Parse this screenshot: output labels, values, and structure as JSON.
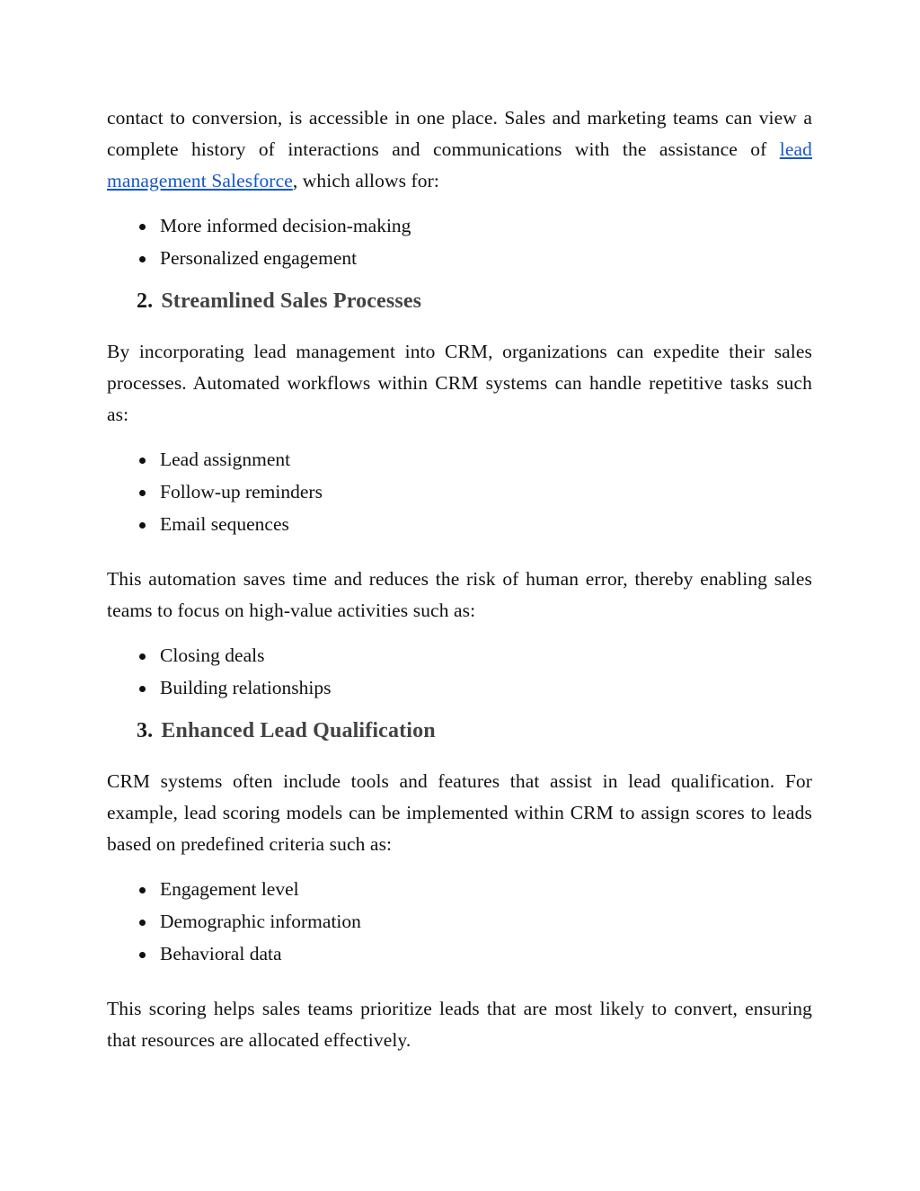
{
  "document": {
    "background_color": "#ffffff",
    "text_color": "#111111",
    "link_color": "#1457cc",
    "heading_color": "#434343",
    "heading_number_color": "#1a1a1a",
    "blocks": {
      "intro_paragraph": {
        "lead_text": "contact to conversion, is accessible in one place. Sales and marketing teams can view a complete history of interactions and communications with the assistance of ",
        "link_text": "lead management Salesforce",
        "tail_text": ", which allows for:"
      },
      "bullets_benefits": [
        "More informed decision-making",
        "Personalized engagement"
      ],
      "heading_two": {
        "number": "2.",
        "title": "Streamlined Sales Processes"
      },
      "paragraph_streamlined": "By incorporating lead management into CRM, organizations can expedite their sales processes. Automated workflows within CRM systems can handle repetitive tasks such as:",
      "bullets_automation": [
        "Lead assignment",
        "Follow-up reminders",
        "Email sequences"
      ],
      "paragraph_automation_saves": "This automation saves time and reduces the risk of human error, thereby enabling sales teams to focus on high-value activities such as:",
      "bullets_highvalue": [
        "Closing deals",
        "Building relationships"
      ],
      "heading_three": {
        "number": "3.",
        "title": "Enhanced Lead Qualification"
      },
      "paragraph_qualification": "CRM systems often include tools and features that assist in lead qualification. For example, lead scoring models can be implemented within CRM to assign scores to leads based on predefined criteria such as:",
      "bullets_criteria": [
        "Engagement level",
        "Demographic information",
        "Behavioral data"
      ],
      "paragraph_scoring": "This scoring helps sales teams prioritize leads that are most likely to convert, ensuring that resources are allocated effectively."
    }
  }
}
